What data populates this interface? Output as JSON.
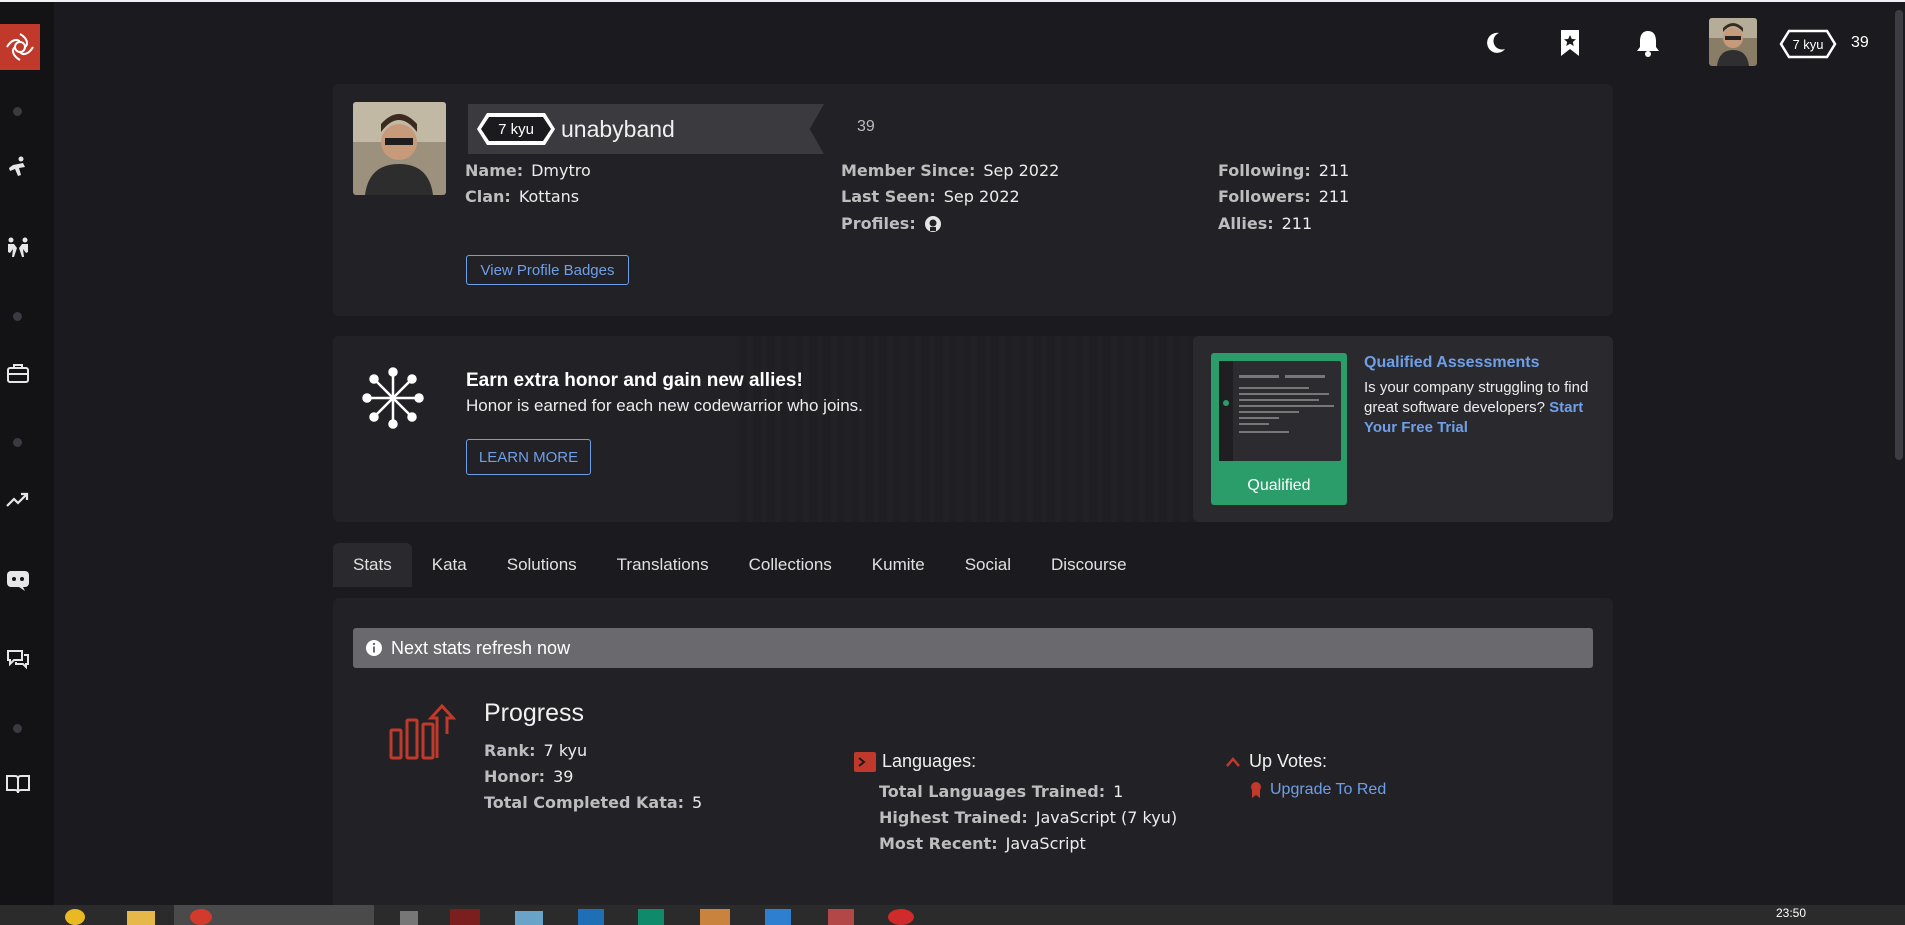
{
  "header": {
    "rank": "7 kyu",
    "honor": "39"
  },
  "profile": {
    "rank": "7 kyu",
    "username": "unabyband",
    "honor": "39",
    "name_label": "Name:",
    "name": "Dmytro",
    "clan_label": "Clan:",
    "clan": "Kottans",
    "member_since_label": "Member Since:",
    "member_since": "Sep 2022",
    "last_seen_label": "Last Seen:",
    "last_seen": "Sep 2022",
    "profiles_label": "Profiles:",
    "following_label": "Following:",
    "following": "211",
    "followers_label": "Followers:",
    "followers": "211",
    "allies_label": "Allies:",
    "allies": "211",
    "badges_button": "View Profile Badges"
  },
  "promo": {
    "title": "Earn extra honor and gain new allies!",
    "text": "Honor is earned for each new codewarrior who joins.",
    "button": "LEARN MORE"
  },
  "qualified": {
    "title": "Qualified Assessments",
    "text": "Is your company struggling to find great software developers?",
    "link": "Start Your Free Trial",
    "thumb_label": "Qualified"
  },
  "tabs": [
    "Stats",
    "Kata",
    "Solutions",
    "Translations",
    "Collections",
    "Kumite",
    "Social",
    "Discourse"
  ],
  "stats": {
    "alert": "Next stats refresh now",
    "progress_title": "Progress",
    "rank_label": "Rank:",
    "rank": "7 kyu",
    "honor_label": "Honor:",
    "honor": "39",
    "completed_label": "Total Completed Kata:",
    "completed": "5",
    "languages_title": "Languages:",
    "trained_label": "Total Languages Trained:",
    "trained": "1",
    "highest_label": "Highest Trained:",
    "highest": "JavaScript (7 kyu)",
    "recent_label": "Most Recent:",
    "recent": "JavaScript",
    "upvotes_title": "Up Votes:",
    "upgrade_link": "Upgrade To Red"
  },
  "taskbar": {
    "time": "23:50"
  },
  "colors": {
    "accent_red": "#c0392b",
    "link_blue": "#6f9fe8",
    "panel": "#222226",
    "background": "#1b1b1f"
  }
}
